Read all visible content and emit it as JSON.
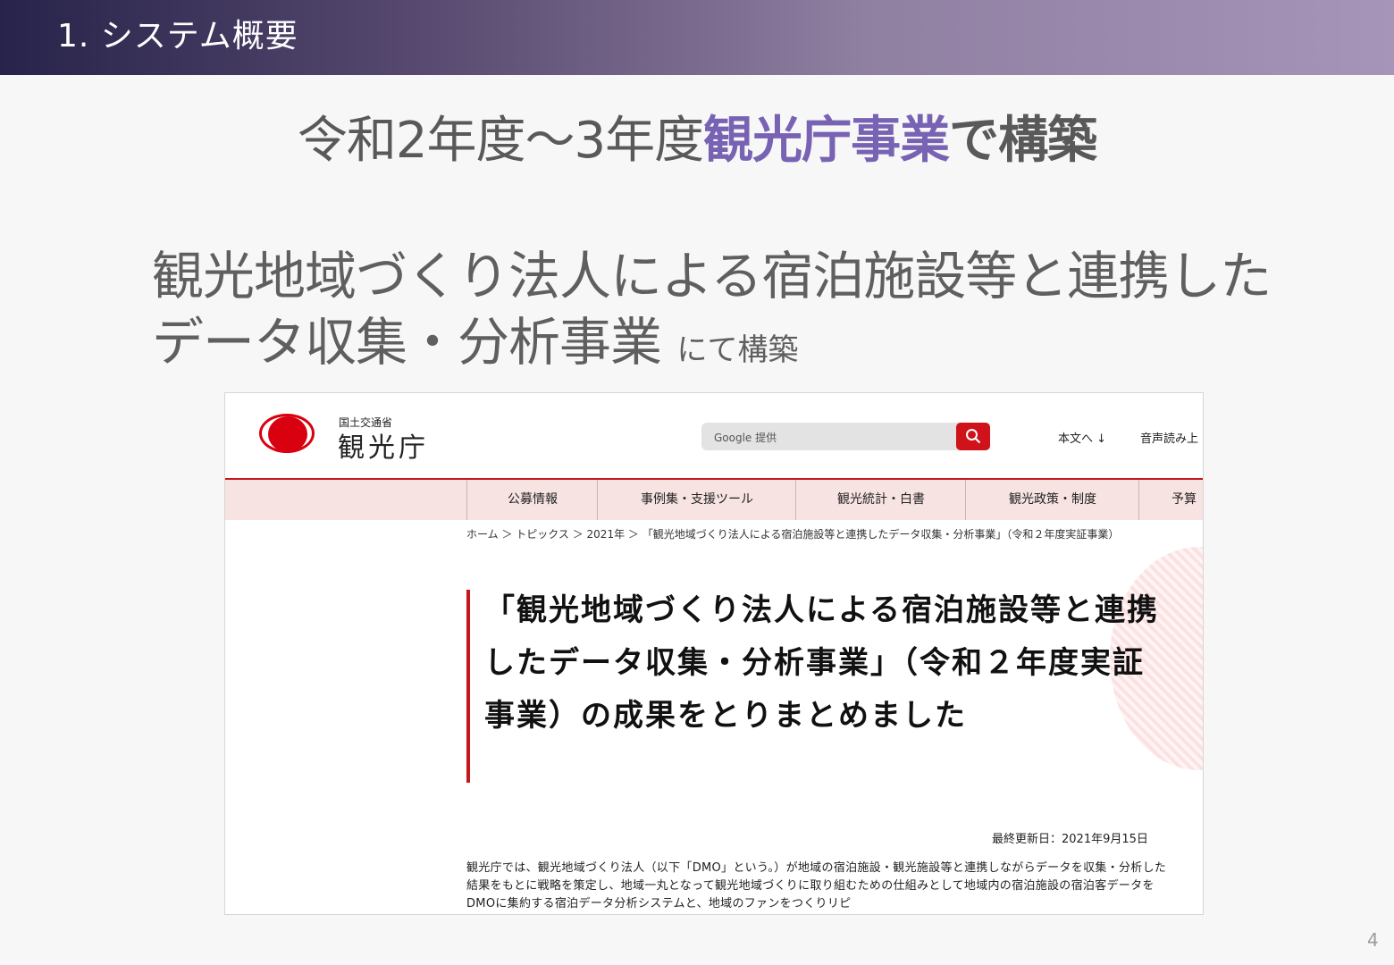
{
  "slide": {
    "header_title": "1. システム概要",
    "title_part1": "令和2年度～3年度",
    "title_highlight": "観光庁事業",
    "title_part2": "で構築",
    "subtitle_line1": "観光地域づくり法人による宿泊施設等と連携した",
    "subtitle_line2": "データ収集・分析事業",
    "subtitle_small": "にて構築",
    "page_number": "4",
    "colors": {
      "header_start": "#27234a",
      "header_end": "#a794b9",
      "highlight": "#7862b3"
    }
  },
  "website": {
    "agency_small": "国土交通省",
    "agency_name": "観光庁",
    "search_placeholder": "Google 提供",
    "skip_link": "本文へ ↓",
    "read_aloud": "音声読み上",
    "nav": [
      "公募情報",
      "事例集・支援ツール",
      "観光統計・白書",
      "観光政策・制度",
      "予算"
    ],
    "breadcrumb": "ホーム ＞ トピックス ＞ 2021年 ＞ 「観光地域づくり法人による宿泊施設等と連携したデータ収集・分析事業」（令和２年度実証事業）",
    "article_title": "「観光地域づくり法人による宿泊施設等と連携したデータ収集・分析事業」（令和２年度実証事業）の成果をとりまとめました",
    "updated": "最終更新日：2021年9月15日",
    "body": "観光庁では、観光地域づくり法人（以下「DMO」という。）が地域の宿泊施設・観光施設等と連携しながらデータを収集・分析した結果をもとに戦略を策定し、地域一丸となって観光地域づくりに取り組むための仕組みとして地域内の宿泊施設の宿泊客データをDMOに集約する宿泊データ分析システムと、地域のファンをつくりリピ",
    "colors": {
      "brand_red": "#c8161d",
      "nav_bg": "#f8e3e3"
    }
  }
}
